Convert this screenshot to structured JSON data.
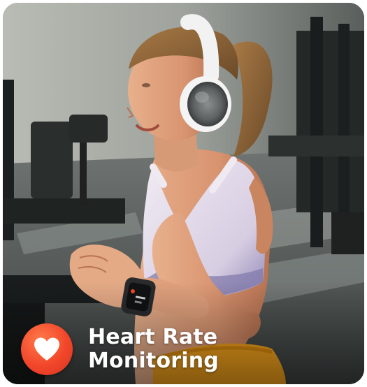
{
  "image": {
    "subject": "woman-running-with-headphones-and-smartwatch",
    "accent_color": "#f2462a",
    "shorts_color": "#f3a21c",
    "top_color": "#dcd3e6"
  },
  "caption": {
    "line1": "Heart Rate",
    "line2": "Monitoring",
    "icon": "heart-icon"
  }
}
